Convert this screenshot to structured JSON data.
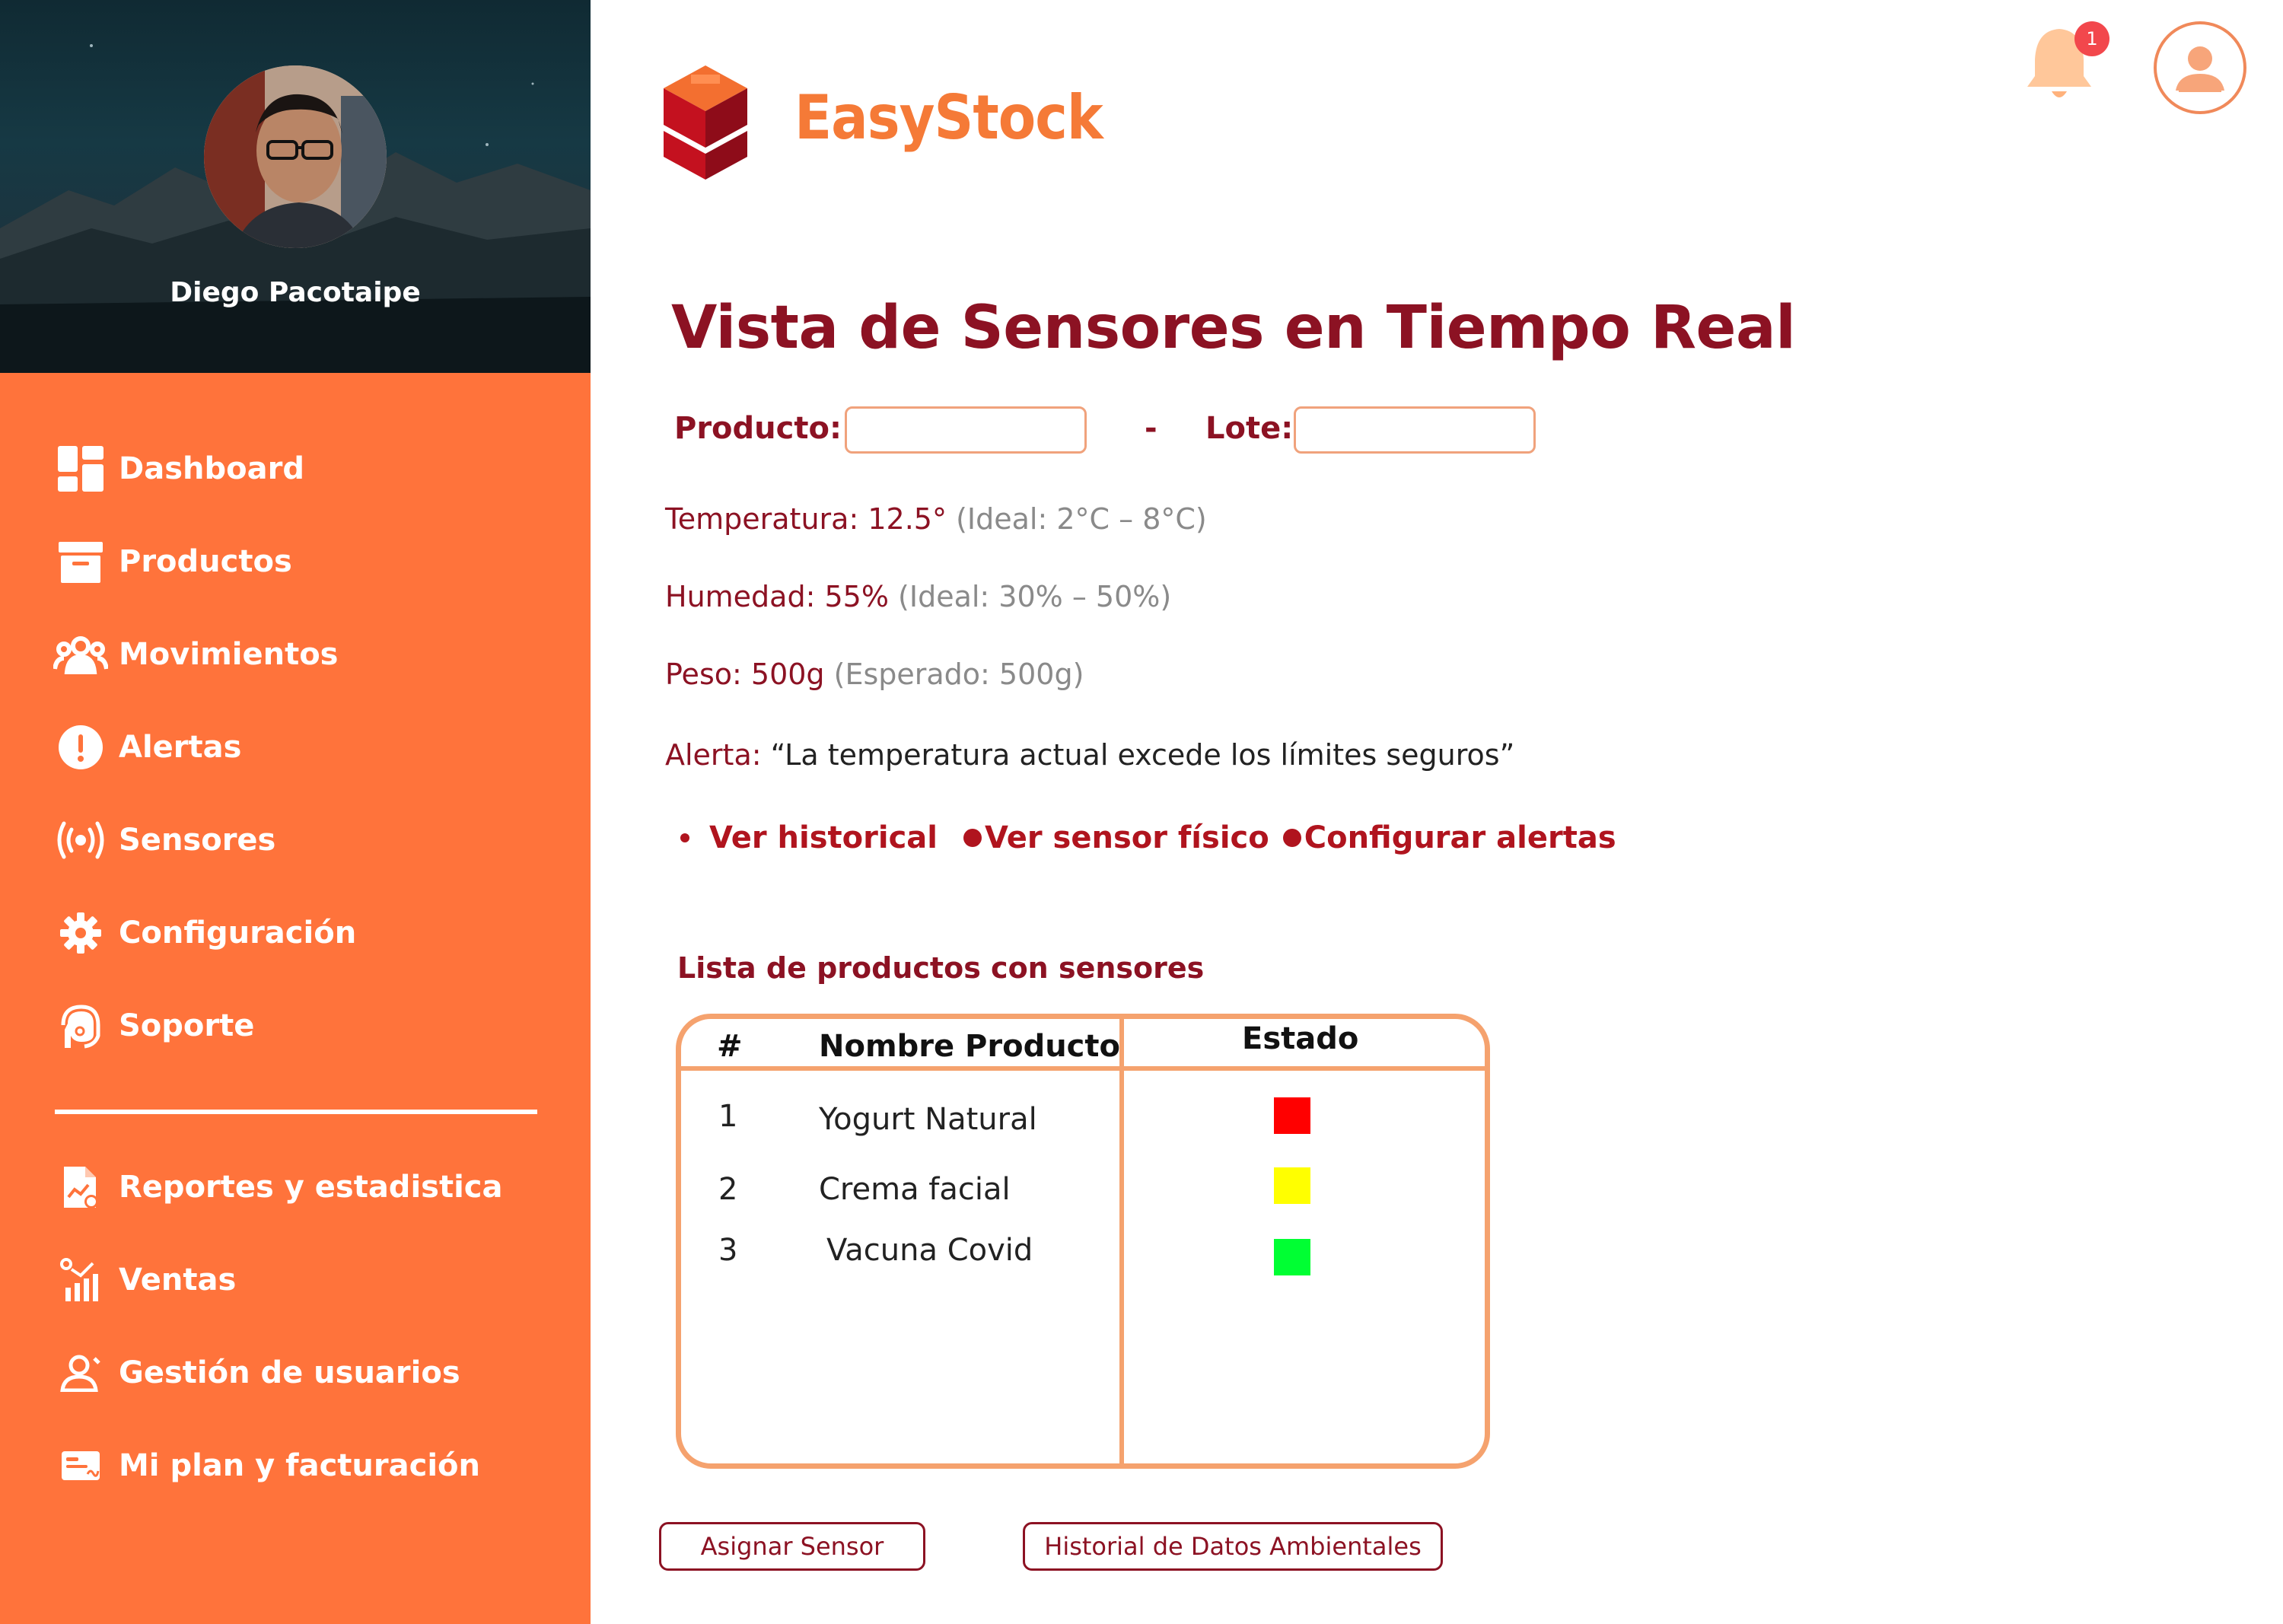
{
  "user": {
    "name": "Diego Pacotaipe"
  },
  "brand": {
    "name": "EasyStock"
  },
  "notifications": {
    "count": "1"
  },
  "sidebar": {
    "items": [
      {
        "label": "Dashboard",
        "icon": "dashboard-icon"
      },
      {
        "label": "Productos",
        "icon": "archive-box-icon"
      },
      {
        "label": "Movimientos",
        "icon": "users-group-icon"
      },
      {
        "label": "Alertas",
        "icon": "exclamation-circle-icon"
      },
      {
        "label": "Sensores",
        "icon": "broadcast-icon"
      },
      {
        "label": "Configuración",
        "icon": "gear-icon"
      },
      {
        "label": "Soporte",
        "icon": "support-headset-icon"
      }
    ],
    "secondary_items": [
      {
        "label": "Reportes y estadistica",
        "icon": "report-chart-icon"
      },
      {
        "label": "Ventas",
        "icon": "sales-chart-icon"
      },
      {
        "label": "Gestión de usuarios",
        "icon": "user-manage-icon"
      },
      {
        "label": "Mi plan y facturación",
        "icon": "billing-card-icon"
      }
    ]
  },
  "main": {
    "title": "Vista de Sensores en Tiempo Real",
    "filters": {
      "product_label": "Producto:",
      "product_value": "",
      "separator": "-",
      "lot_label": "Lote:",
      "lot_value": ""
    },
    "readings": {
      "temperature": {
        "key": "Temperatura:",
        "value": "12.5°",
        "ideal": "(Ideal: 2°C – 8°C)"
      },
      "humidity": {
        "key": "Humedad:",
        "value": "55%",
        "ideal": "(Ideal: 30% – 50%)"
      },
      "weight": {
        "key": "Peso:",
        "value": "500g",
        "ideal": "(Esperado: 500g)"
      },
      "alert": {
        "key": "Alerta:",
        "message": "“La temperatura actual excede los límites seguros”"
      }
    },
    "links": [
      "Ver historical",
      "Ver sensor físico",
      "Configurar alertas"
    ],
    "table": {
      "title": "Lista de productos con sensores",
      "headers": {
        "num": "#",
        "name": "Nombre Producto",
        "status": "Estado"
      },
      "rows": [
        {
          "num": "1",
          "name": "Yogurt Natural",
          "status_color": "#FF0000"
        },
        {
          "num": "2",
          "name": "Crema facial",
          "status_color": "#FFFF00"
        },
        {
          "num": "3",
          "name": "Vacuna Covid",
          "status_color": "#00FF33"
        }
      ]
    },
    "buttons": {
      "assign_sensor": "Asignar Sensor",
      "history": "Historial de Datos Ambientales"
    }
  },
  "colors": {
    "sidebar_bg": "#FF733B",
    "primary_dark_red": "#8C1223",
    "link_red": "#B0141E",
    "brand_orange": "#F57A37",
    "table_border": "#F5A26E"
  }
}
